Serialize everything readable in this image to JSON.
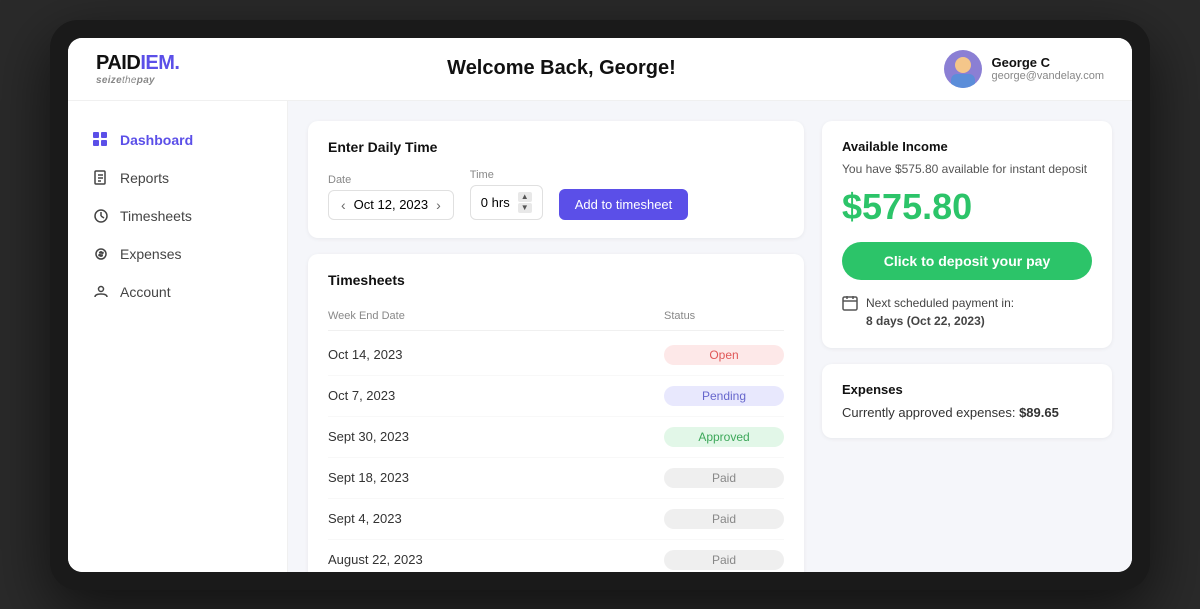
{
  "logo": {
    "text_paid": "PAID",
    "text_iem": "IEM.",
    "tagline_seize": "seize",
    "tagline_the": "the",
    "tagline_pay": "pay"
  },
  "header": {
    "title": "Welcome Back, George!",
    "user_name": "George C",
    "user_email": "george@vandelay.com"
  },
  "sidebar": {
    "items": [
      {
        "id": "dashboard",
        "label": "Dashboard",
        "active": true
      },
      {
        "id": "reports",
        "label": "Reports",
        "active": false
      },
      {
        "id": "timesheets",
        "label": "Timesheets",
        "active": false
      },
      {
        "id": "expenses",
        "label": "Expenses",
        "active": false
      },
      {
        "id": "account",
        "label": "Account",
        "active": false
      }
    ]
  },
  "daily_time": {
    "title": "Enter Daily Time",
    "date_label": "Date",
    "time_label": "Time",
    "date_value": "Oct 12, 2023",
    "time_value": "0 hrs",
    "add_button": "Add to timesheet"
  },
  "timesheets": {
    "title": "Timesheets",
    "col_week_end": "Week End Date",
    "col_status": "Status",
    "rows": [
      {
        "date": "Oct 14, 2023",
        "status": "Open",
        "status_type": "open"
      },
      {
        "date": "Oct 7, 2023",
        "status": "Pending",
        "status_type": "pending"
      },
      {
        "date": "Sept 30, 2023",
        "status": "Approved",
        "status_type": "approved"
      },
      {
        "date": "Sept 18, 2023",
        "status": "Paid",
        "status_type": "paid"
      },
      {
        "date": "Sept 4, 2023",
        "status": "Paid",
        "status_type": "paid"
      },
      {
        "date": "August 22, 2023",
        "status": "Paid",
        "status_type": "paid"
      }
    ]
  },
  "available_income": {
    "title": "Available Income",
    "description": "You have $575.80 available for instant deposit",
    "amount": "$575.80",
    "deposit_button": "Click to deposit your pay",
    "scheduled_label": "Next scheduled payment in:",
    "scheduled_value": "8 days (Oct 22, 2023)"
  },
  "expenses": {
    "title": "Expenses",
    "description": "Currently approved expenses:",
    "amount": "$89.65"
  }
}
